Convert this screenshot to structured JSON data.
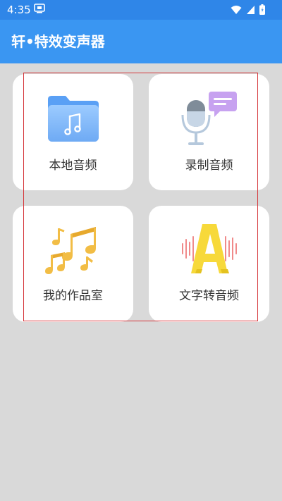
{
  "status_bar": {
    "time": "4:35",
    "icons": [
      "notification-icon",
      "wifi-icon",
      "signal-icon",
      "battery-icon"
    ]
  },
  "app_bar": {
    "title": "轩•特效变声器"
  },
  "colors": {
    "status_bar": "#2f86e8",
    "app_bar": "#3a96f2",
    "background": "#d9d9d9",
    "card": "#ffffff",
    "highlight_border": "#d5363a"
  },
  "grid": {
    "items": [
      {
        "label": "本地音频",
        "icon": "folder-music-icon"
      },
      {
        "label": "录制音频",
        "icon": "microphone-chat-icon"
      },
      {
        "label": "我的作品室",
        "icon": "music-notes-icon"
      },
      {
        "label": "文字转音频",
        "icon": "letter-a-soundwave-icon"
      }
    ]
  }
}
